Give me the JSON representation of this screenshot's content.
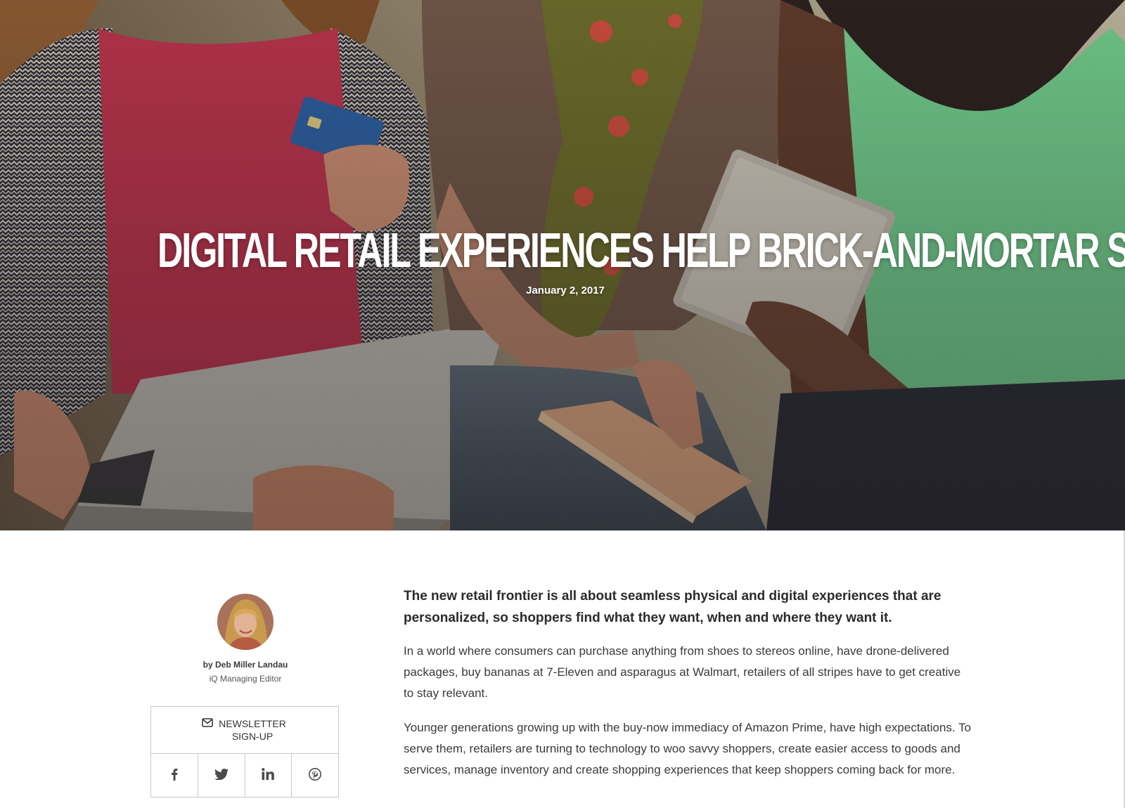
{
  "hero": {
    "title": "DIGITAL RETAIL EXPERIENCES HELP BRICK-AND-MORTAR STORES STAY RELEVANT",
    "date": "January 2, 2017"
  },
  "author": {
    "byline": "by Deb Miller Landau",
    "role": "iQ Managing Editor"
  },
  "newsletter": {
    "label_line1": "NEWSLETTER",
    "label_line2": "SIGN-UP"
  },
  "social": {
    "icons": [
      "facebook-icon",
      "twitter-icon",
      "linkedin-icon",
      "pinterest-icon"
    ]
  },
  "article": {
    "lede": "The new retail frontier is all about seamless physical and digital experiences that are personalized, so shoppers find what they want, when and where they want it.",
    "paragraphs": [
      "In a world where consumers can purchase anything from shoes to stereos online, have drone-delivered packages, buy bananas at 7-Eleven and asparagus at Walmart, retailers of all stripes have to get creative to stay relevant.",
      "Younger generations growing up with the buy-now immediacy of Amazon Prime, have high expectations. To serve them, retailers are turning to technology to woo savvy shoppers, create easier access to goods and services, manage inventory and create shopping experiences that keep shoppers coming back for more."
    ]
  },
  "colors": {
    "text": "#2b2b2b",
    "border": "#c9c9c9",
    "hero_text": "#ffffff"
  }
}
